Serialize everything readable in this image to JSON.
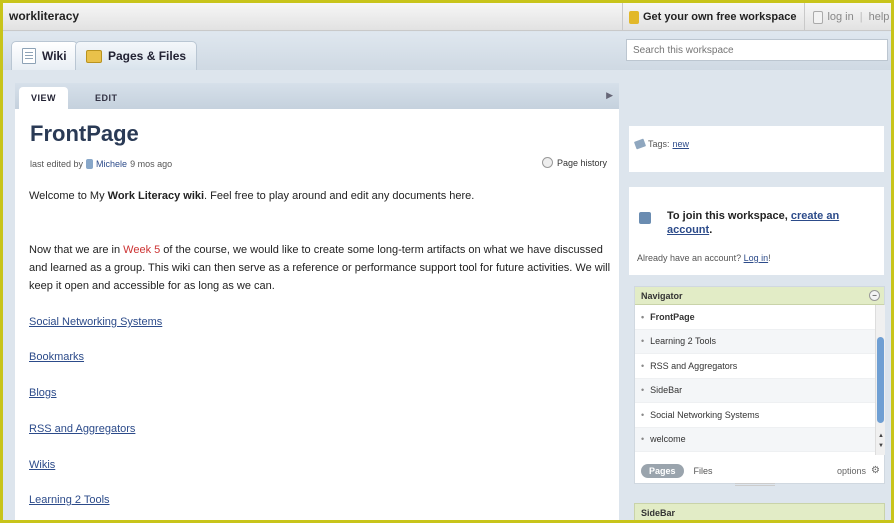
{
  "topbar": {
    "workspace_name": "workliteracy",
    "free_workspace": "Get your own free workspace",
    "log_in": "log in",
    "help": "help"
  },
  "nav": {
    "tabs": [
      {
        "label": "Wiki",
        "icon": "document-icon"
      },
      {
        "label": "Pages & Files",
        "icon": "folder-icon"
      }
    ],
    "search_placeholder": "Search this workspace"
  },
  "content": {
    "tabs": [
      "VIEW",
      "EDIT"
    ],
    "title": "FrontPage",
    "meta_prefix": "last edited by",
    "editor": "Michele",
    "edited_ago": "9 mos ago",
    "page_history": "Page history",
    "para1_pre": "Welcome to My ",
    "para1_bold": "Work Literacy wiki",
    "para1_post": ". Feel free to play around and edit any documents here.",
    "para2_pre": "Now that we are in ",
    "para2_week": "Week 5",
    "para2_post": " of the course, we would like to create some long-term artifacts on what we have discussed and learned as a group. This wiki can then serve as a reference or performance support tool for future activities. We will keep it open and accessible for as long as we can.",
    "links": [
      "Social Networking Systems",
      "Bookmarks",
      "Blogs",
      "RSS and Aggregators",
      "Wikis",
      "Learning 2 Tools"
    ]
  },
  "sidebar": {
    "tags_label": "Tags:",
    "tag": "new",
    "join_pre": "To join this workspace, ",
    "join_link": "create an account",
    "join_post": ".",
    "already_pre": "Already have an account? ",
    "already_link": "Log in",
    "already_post": "!",
    "navigator_title": "Navigator",
    "navigator_items": [
      "FrontPage",
      "Learning 2 Tools",
      "RSS and Aggregators",
      "SideBar",
      "Social Networking Systems",
      "welcome"
    ],
    "pages_label": "Pages",
    "files_label": "Files",
    "options_label": "options",
    "sidebar_title": "SideBar"
  }
}
